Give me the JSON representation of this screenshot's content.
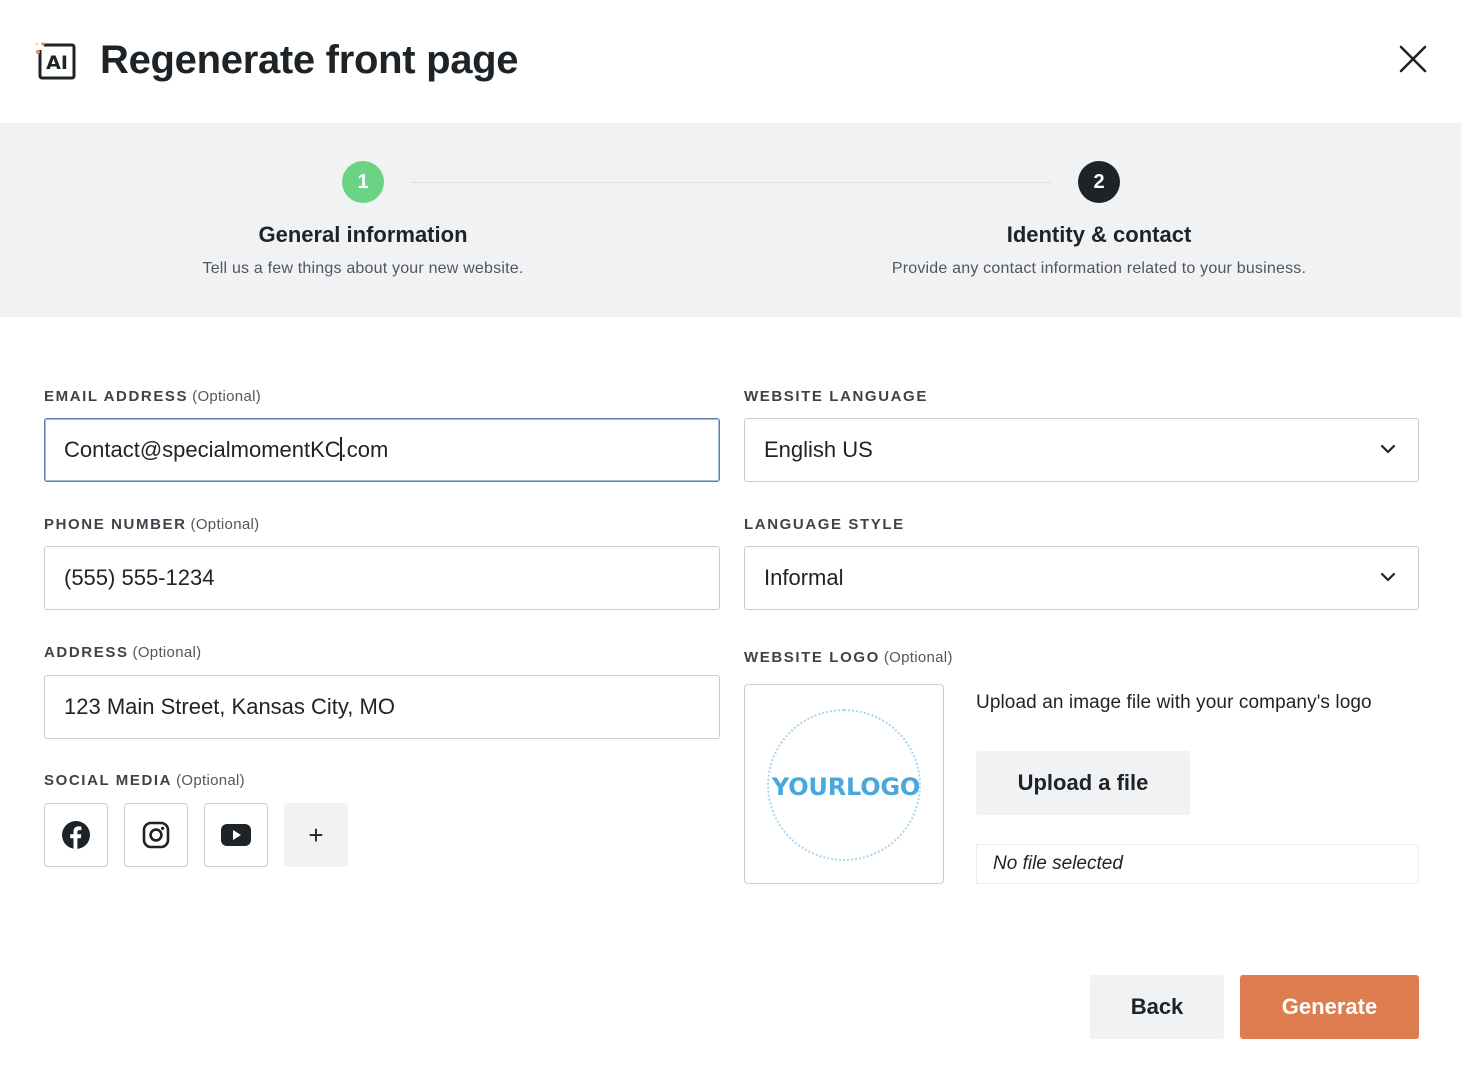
{
  "header": {
    "title": "Regenerate front page",
    "icon_text": "AI"
  },
  "stepper": {
    "steps": [
      {
        "number": "1",
        "title": "General information",
        "description": "Tell us a few things about your new website.",
        "state": "done",
        "color": "#6ad384"
      },
      {
        "number": "2",
        "title": "Identity & contact",
        "description": "Provide any contact information related to your business.",
        "state": "active",
        "color": "#1d2327"
      }
    ]
  },
  "form": {
    "email": {
      "label": "EMAIL ADDRESS",
      "optional": "(Optional)",
      "value_before_caret": "Contact@specialmomentKC",
      "value_after_caret": ".com"
    },
    "phone": {
      "label": "PHONE NUMBER",
      "optional": "(Optional)",
      "value": "(555) 555-1234"
    },
    "address": {
      "label": "ADDRESS",
      "optional": "(Optional)",
      "value": "123 Main Street, Kansas City, MO"
    },
    "social": {
      "label": "SOCIAL MEDIA",
      "optional": "(Optional)",
      "icons": [
        "facebook-icon",
        "instagram-icon",
        "youtube-icon"
      ],
      "add_label": "+"
    },
    "language": {
      "label": "WEBSITE LANGUAGE",
      "value": "English US"
    },
    "style": {
      "label": "LANGUAGE STYLE",
      "value": "Informal"
    },
    "logo": {
      "label": "WEBSITE LOGO",
      "optional": "(Optional)",
      "placeholder_text": "YOURLOGO",
      "description": "Upload an image file with your company's logo",
      "upload_label": "Upload a file",
      "file_status": "No file selected"
    }
  },
  "footer": {
    "back_label": "Back",
    "generate_label": "Generate",
    "generate_color": "#de7d4f"
  }
}
